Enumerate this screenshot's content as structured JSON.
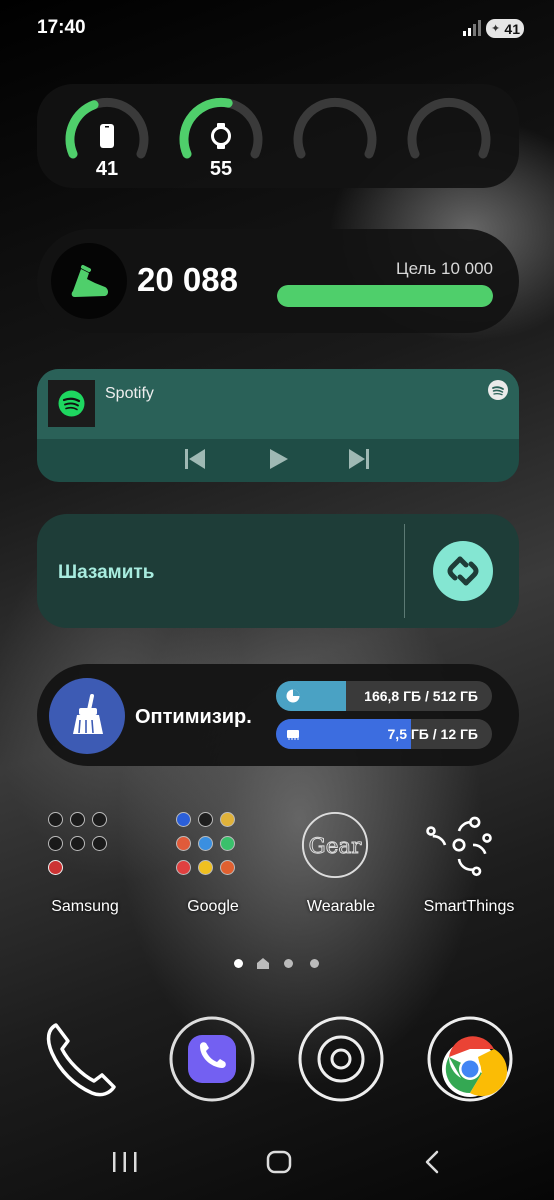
{
  "status_bar": {
    "time": "17:40",
    "battery": "41"
  },
  "battery_rings": [
    {
      "device": "phone-icon",
      "value": "41",
      "level": 0.41,
      "color": "#4fcf6b"
    },
    {
      "device": "watch-icon",
      "value": "55",
      "level": 0.55,
      "color": "#4fcf6b"
    },
    {
      "device": "",
      "value": "",
      "level": 0,
      "color": "#4fcf6b"
    },
    {
      "device": "",
      "value": "",
      "level": 0,
      "color": "#4fcf6b"
    }
  ],
  "steps": {
    "count": "20 088",
    "goal": "Цель 10 000",
    "progress": 1.0,
    "color": "#4fcf6b"
  },
  "spotify": {
    "title": "Spotify",
    "controls": [
      "previous-icon",
      "play-icon",
      "next-icon"
    ]
  },
  "shazam": {
    "label": "Шазамить"
  },
  "optimize": {
    "label": "Оптимизир.",
    "storage": {
      "text": "166,8 ГБ / 512 ГБ",
      "fraction": 0.326,
      "color": "#4aa2c4"
    },
    "ram": {
      "text": "7,5 ГБ / 12 ГБ",
      "fraction": 0.625,
      "color": "#3c6de0"
    }
  },
  "folders": [
    {
      "label": "Samsung"
    },
    {
      "label": "Google"
    },
    {
      "label": "Wearable"
    },
    {
      "label": "SmartThings"
    }
  ],
  "dock": [
    "phone-icon",
    "viber-icon",
    "camera-icon",
    "chrome-icon"
  ],
  "navigation": [
    "recents-button",
    "home-button",
    "back-button"
  ]
}
